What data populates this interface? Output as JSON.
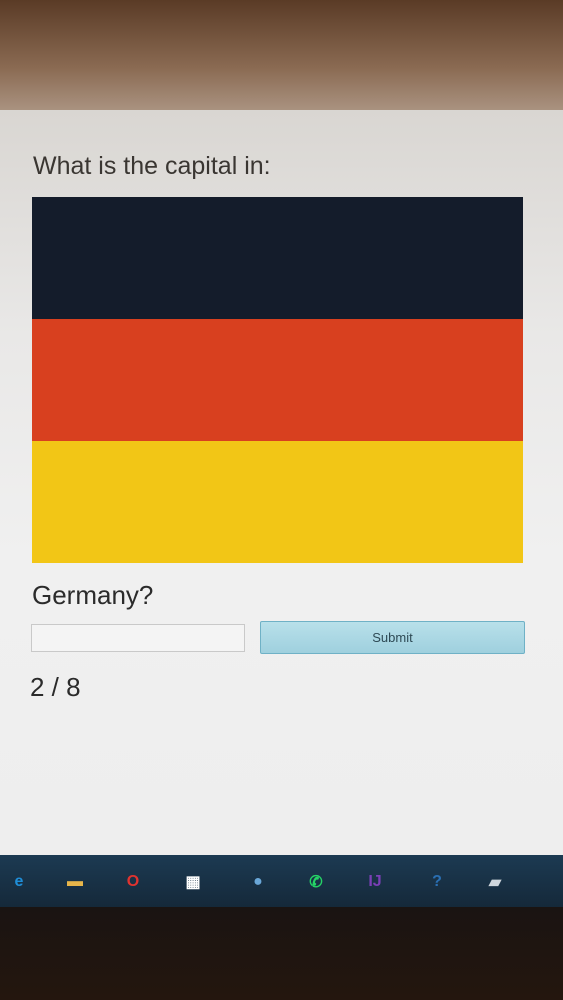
{
  "quiz": {
    "question": "What is the capital in:",
    "country": "Germany?",
    "answer_value": "",
    "submit_label": "Submit",
    "progress": "2 / 8",
    "flag_colors": [
      "#141c2b",
      "#d8401f",
      "#f2c616"
    ]
  },
  "taskbar": {
    "icons": [
      {
        "name": "edge-browser-icon",
        "color": "#1f8ed8"
      },
      {
        "name": "file-explorer-icon",
        "color": "#e8b64a"
      },
      {
        "name": "opera-browser-icon",
        "color": "#e0332f"
      },
      {
        "name": "microsoft-store-icon",
        "color": "#ffffff"
      },
      {
        "name": "chrome-profile-icon",
        "color": "#6aa7d8"
      },
      {
        "name": "whatsapp-icon",
        "color": "#25d366"
      },
      {
        "name": "intellij-icon",
        "color": "#7a3fb6"
      },
      {
        "name": "help-icon",
        "color": "#2a6fb3"
      },
      {
        "name": "notes-app-icon",
        "color": "#cfd6dc"
      }
    ]
  }
}
